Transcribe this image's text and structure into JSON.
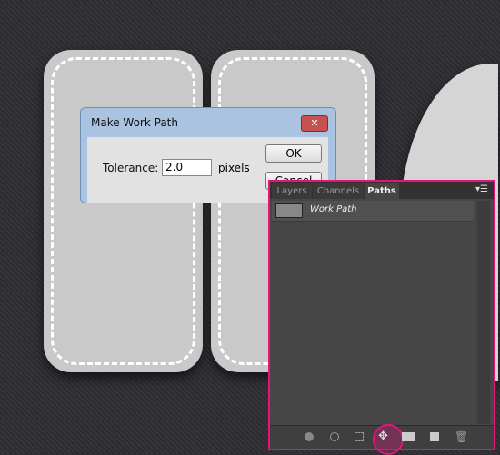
{
  "dialog": {
    "title": "Make Work Path",
    "close_icon": "close-icon",
    "tolerance_label": "Tolerance:",
    "tolerance_value": "2.0",
    "unit": "pixels",
    "ok": "OK",
    "cancel": "Cancel"
  },
  "panel": {
    "tabs": [
      {
        "label": "Layers"
      },
      {
        "label": "Channels"
      },
      {
        "label": "Paths",
        "active": true
      }
    ],
    "menu_icon": "panel-menu-icon",
    "paths": [
      {
        "name": "Work Path"
      }
    ],
    "toolbar": [
      "fill-path-icon",
      "stroke-path-icon",
      "load-selection-icon",
      "make-work-path-icon",
      "add-mask-icon",
      "new-path-icon",
      "delete-icon"
    ],
    "highlight_color": "#e8137a"
  }
}
